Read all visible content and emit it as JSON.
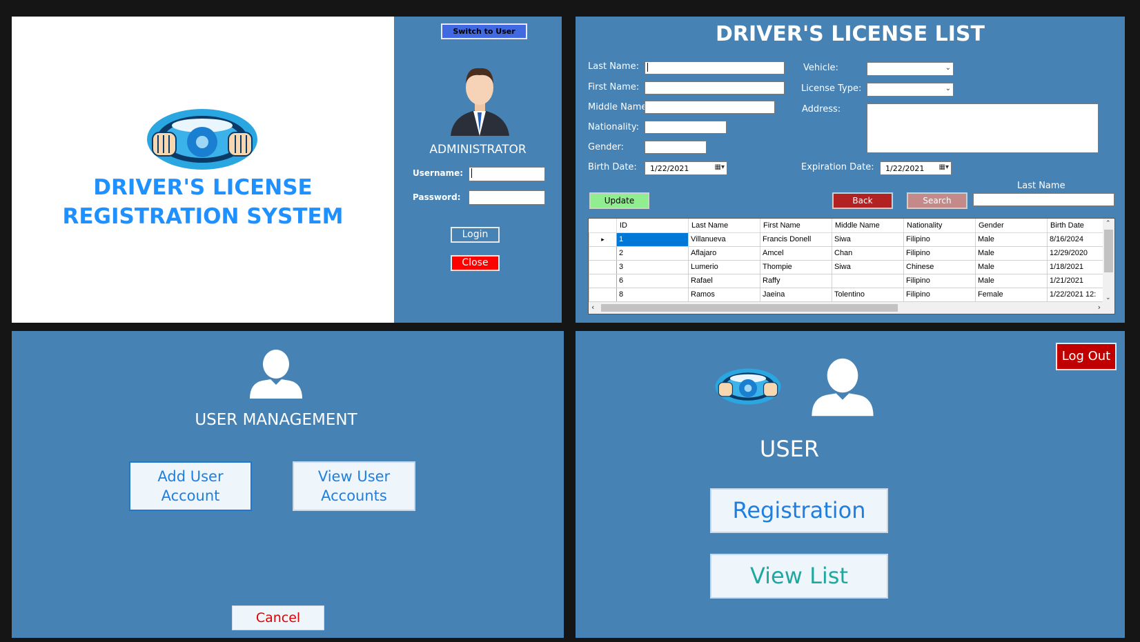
{
  "login": {
    "switch_button": "Switch to User",
    "title_line1": "DRIVER'S LICENSE",
    "title_line2": "REGISTRATION SYSTEM",
    "role": "ADMINISTRATOR",
    "username_label": "Username:",
    "password_label": "Password:",
    "login_button": "Login",
    "close_button": "Close"
  },
  "list": {
    "title": "DRIVER'S LICENSE LIST",
    "fields": {
      "last_name": "Last Name:",
      "first_name": "First Name:",
      "middle_name": "Middle Name:",
      "nationality": "Nationality:",
      "gender": "Gender:",
      "birth_date": "Birth Date:",
      "vehicle": "Vehicle:",
      "license_type": "License Type:",
      "address": "Address:",
      "expiration_date": "Expiration Date:"
    },
    "birth_date_value": "1/22/2021",
    "expiration_date_value": "1/22/2021",
    "search_label": "Last Name",
    "update_button": "Update",
    "back_button": "Back",
    "search_button": "Search",
    "columns": [
      "ID",
      "Last Name",
      "First Name",
      "Middle Name",
      "Nationality",
      "Gender",
      "Birth Date"
    ],
    "rows": [
      [
        "1",
        "Villanueva",
        "Francis Donell",
        "Siwa",
        "Filipino",
        "Male",
        "8/16/2024"
      ],
      [
        "2",
        "Aflajaro",
        "Amcel",
        "Chan",
        "Filipino",
        "Male",
        "12/29/2020"
      ],
      [
        "3",
        "Lumerio",
        "Thompie",
        "Siwa",
        "Chinese",
        "Male",
        "1/18/2021"
      ],
      [
        "6",
        "Rafael",
        "Raffy",
        "",
        "Filipino",
        "Male",
        "1/21/2021"
      ],
      [
        "8",
        "Ramos",
        "Jaeina",
        "Tolentino",
        "Filipino",
        "Female",
        "1/22/2021 12:"
      ]
    ]
  },
  "usermgmt": {
    "title": "USER MANAGEMENT",
    "add_line1": "Add User",
    "add_line2": "Account",
    "view_line1": "View User",
    "view_line2": "Accounts",
    "cancel_button": "Cancel"
  },
  "user": {
    "logout_button": "Log Out",
    "title": "USER",
    "registration_button": "Registration",
    "view_list_button": "View List"
  },
  "colors": {
    "panel_bg": "#4682b4",
    "title_blue": "#1e90ff",
    "danger_red": "#c80000",
    "update_green": "#90ee90"
  },
  "icons": [
    "steering-wheel-logo-icon",
    "administrator-avatar-icon",
    "user-silhouette-icon",
    "dropdown-arrow-icon",
    "calendar-icon"
  ]
}
